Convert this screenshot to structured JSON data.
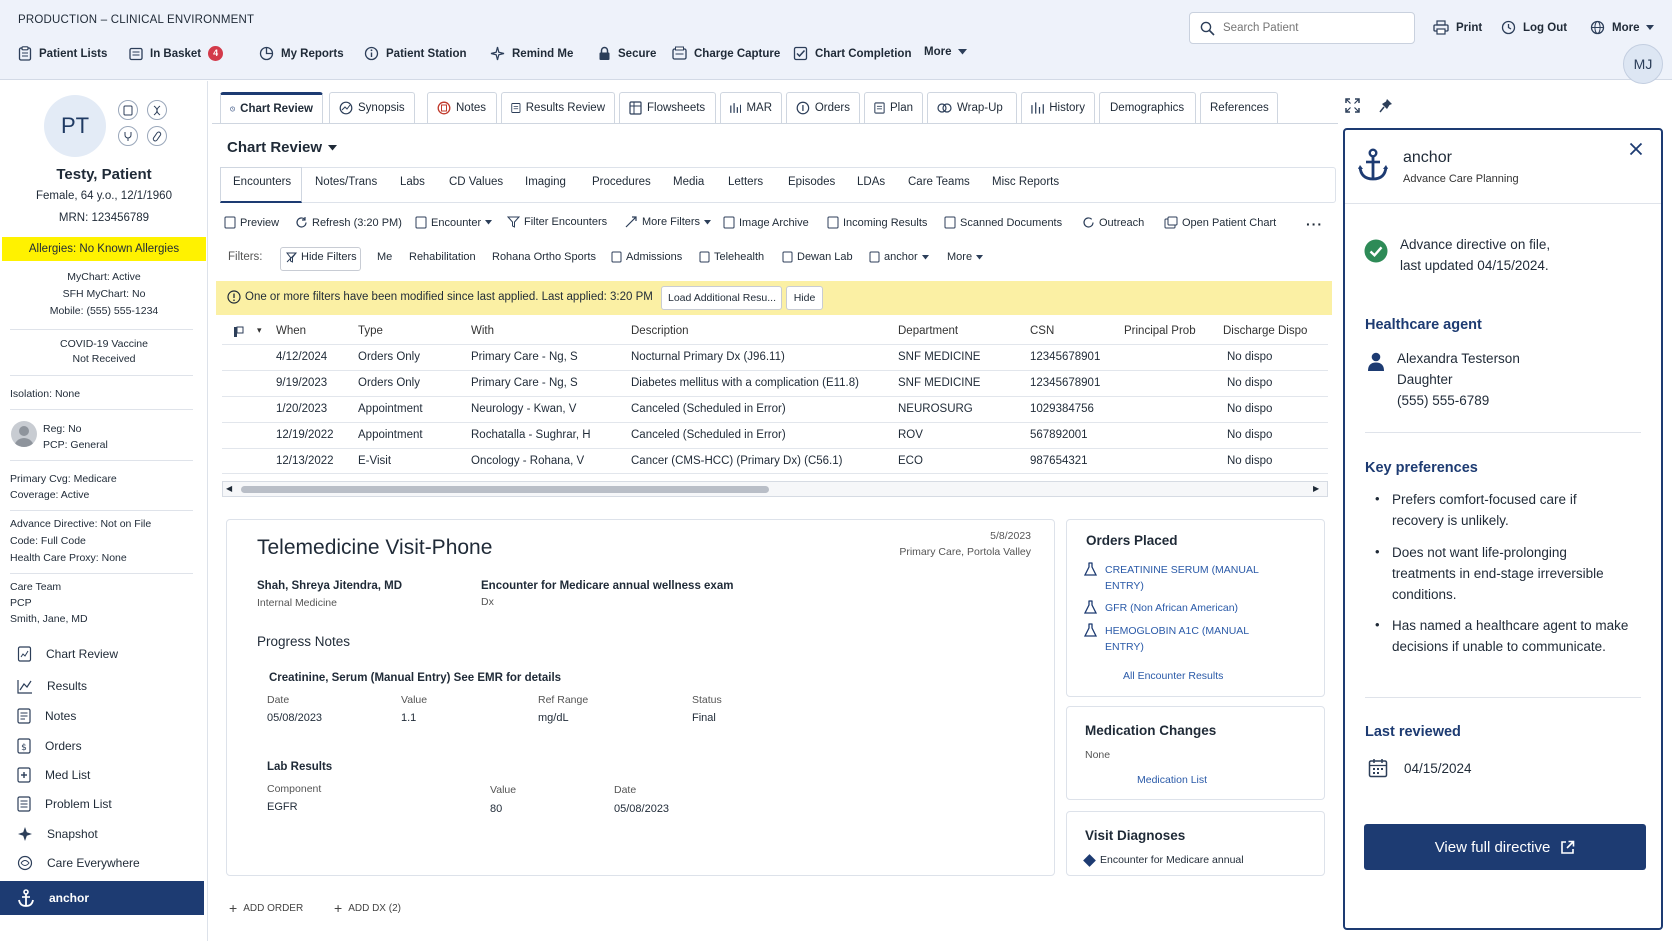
{
  "header": {
    "environment": "PRODUCTION – CLINICAL ENVIRONMENT",
    "menu": [
      {
        "label": "Patient Lists",
        "icon": "clipboard-icon"
      },
      {
        "label": "In Basket",
        "icon": "inbox-icon",
        "badge": "4"
      },
      {
        "label": "My Reports",
        "icon": "reports-icon"
      },
      {
        "label": "Patient Station",
        "icon": "info-icon"
      },
      {
        "label": "Remind Me",
        "icon": "sparkle-icon"
      },
      {
        "label": "Secure",
        "icon": "lock-icon"
      },
      {
        "label": "Charge Capture",
        "icon": "charge-icon"
      },
      {
        "label": "Chart Completion",
        "icon": "check-doc-icon"
      },
      {
        "label": "More",
        "icon": "chevron-down-icon"
      }
    ],
    "search_placeholder": "Search Patient",
    "print": "Print",
    "logout": "Log Out",
    "more": "More",
    "user_initials": "MJ"
  },
  "patient": {
    "initials": "PT",
    "name": "Testy, Patient",
    "demographics": "Female, 64 y.o., 12/1/1960",
    "mrn": "MRN: 123456789",
    "allergies": "Allergies: No Known Allergies",
    "mychart": "MyChart: Active",
    "sfh_mychart": "SFH MyChart: No",
    "mobile": "Mobile: (555) 555-1234",
    "covid_1": "COVID-19 Vaccine",
    "covid_2": "Not Received",
    "isolation": "Isolation: None",
    "reg": "Reg: No",
    "pcp": "PCP:  General",
    "primary_cvg": "Primary Cvg: Medicare",
    "coverage": "Coverage: Active",
    "advance_directive": "Advance Directive: Not on File",
    "code": "Code: Full Code",
    "proxy": "Health Care Proxy: None",
    "care_team": "Care Team",
    "care_team_role": "PCP",
    "care_team_member": "Smith, Jane, MD"
  },
  "sidenav": [
    {
      "label": "Chart Review",
      "icon": "chart-review-icon"
    },
    {
      "label": "Results",
      "icon": "results-icon"
    },
    {
      "label": "Notes",
      "icon": "notes-icon"
    },
    {
      "label": "Orders",
      "icon": "orders-icon"
    },
    {
      "label": "Med List",
      "icon": "med-list-icon"
    },
    {
      "label": "Problem List",
      "icon": "problem-list-icon"
    },
    {
      "label": "Snapshot",
      "icon": "snapshot-icon"
    },
    {
      "label": "Care Everywhere",
      "icon": "care-everywhere-icon"
    },
    {
      "label": "anchor",
      "icon": "anchor-icon",
      "active": true
    }
  ],
  "tabs": [
    "Chart Review",
    "Synopsis",
    "Notes",
    "Results Review",
    "Flowsheets",
    "MAR",
    "Orders",
    "Plan",
    "Wrap-Up",
    "History",
    "Demographics",
    "References"
  ],
  "section_title": "Chart Review",
  "subtabs": [
    "Encounters",
    "Notes/Trans",
    "Labs",
    "CD Values",
    "Imaging",
    "Procedures",
    "Media",
    "Letters",
    "Episodes",
    "LDAs",
    "Care Teams",
    "Misc Reports"
  ],
  "toolbar": [
    "Preview",
    "Refresh (3:20 PM)",
    "Encounter",
    "Filter Encounters",
    "More Filters",
    "Image Archive",
    "Incoming Results",
    "Scanned Documents",
    "Outreach",
    "Open Patient Chart"
  ],
  "filters": {
    "label": "Filters:",
    "items": [
      "Hide Filters",
      "Me",
      "Rehabilitation",
      "Rohana Ortho Sports",
      "Admissions",
      "Telehealth",
      "Dewan Lab",
      "anchor",
      "More"
    ]
  },
  "notice": {
    "text": "One or more filters have been modified since last applied. Last applied: 3:20 PM",
    "load": "Load Additional Resu...",
    "hide": "Hide"
  },
  "table": {
    "headers": [
      "When",
      "Type",
      "With",
      "Description",
      "Department",
      "CSN",
      "Principal Prob",
      "Discharge Dispo"
    ],
    "rows": [
      [
        "4/12/2024",
        "Orders Only",
        "Primary Care - Ng, S",
        "Nocturnal Primary Dx (J96.11)",
        "SNF MEDICINE",
        "12345678901",
        "",
        "No dispo"
      ],
      [
        "9/19/2023",
        "Orders Only",
        "Primary Care - Ng, S",
        "Diabetes mellitus with a complication (E11.8)",
        "SNF MEDICINE",
        "12345678901",
        "",
        "No dispo"
      ],
      [
        "1/20/2023",
        "Appointment",
        "Neurology - Kwan, V",
        "Canceled (Scheduled in Error)",
        "NEUROSURG",
        "1029384756",
        "",
        "No dispo"
      ],
      [
        "12/19/2022",
        "Appointment",
        "Rochatalla - Sughrar, H",
        "Canceled (Scheduled in Error)",
        "ROV",
        "567892001",
        "",
        "No dispo"
      ],
      [
        "12/13/2022",
        "E-Visit",
        "Oncology - Rohana, V",
        "Cancer (CMS-HCC) (Primary Dx) (C56.1)",
        "ECO",
        "987654321",
        "",
        "No dispo"
      ]
    ]
  },
  "encounter": {
    "title": "Telemedicine Visit-Phone",
    "date": "5/8/2023",
    "location": "Primary Care, Portola Valley",
    "provider": "Shah, Shreya Jitendra, MD",
    "specialty": "Internal Medicine",
    "reason": "Encounter for Medicare annual wellness exam",
    "reason_sub": "Dx",
    "progress_notes": "Progress Notes",
    "lab_title": "Creatinine, Serum (Manual Entry) See EMR for details",
    "lab_headers": [
      "Date",
      "Value",
      "Ref Range",
      "Status"
    ],
    "lab_values": [
      "05/08/2023",
      "1.1",
      "mg/dL",
      "Final"
    ],
    "lab_results": "Lab Results",
    "result_headers": [
      "Component",
      "Value",
      "Date"
    ],
    "result_values": [
      "EGFR",
      "80",
      "05/08/2023"
    ],
    "add_order": "ADD ORDER",
    "add_dx": "ADD DX (2)"
  },
  "orders_placed": {
    "title": "Orders Placed",
    "items": [
      "CREATININE SERUM (MANUAL ENTRY)",
      "GFR (Non African American)",
      "HEMOGLOBIN A1C (MANUAL ENTRY)"
    ],
    "link": "All Encounter Results"
  },
  "med_changes": {
    "title": "Medication Changes",
    "value": "None",
    "link": "Medication List"
  },
  "visit_dx": {
    "title": "Visit Diagnoses",
    "item": "Encounter for Medicare annual"
  },
  "anchor_panel": {
    "title": "anchor",
    "subtitle": "Advance Care Planning",
    "status_line1": "Advance directive on file,",
    "status_line2": "last updated 04/15/2024.",
    "agent_heading": "Healthcare agent",
    "agent_name": "Alexandra Testerson",
    "agent_relation": "Daughter",
    "agent_phone": "(555) 555-6789",
    "prefs_heading": "Key preferences",
    "prefs": [
      "Prefers comfort-focused care if recovery is unlikely.",
      "Does not want life-prolonging treatments in end-stage irreversible conditions.",
      "Has named a healthcare agent to make decisions if unable to communicate."
    ],
    "reviewed_heading": "Last reviewed",
    "reviewed_date": "04/15/2024",
    "button": "View full directive"
  },
  "colors": {
    "navy": "#1d3b72",
    "allergy_yellow": "#fff200",
    "notice_yellow": "#fbf0a4",
    "success_green": "#2e8b57",
    "badge_red": "#d33a4a"
  }
}
